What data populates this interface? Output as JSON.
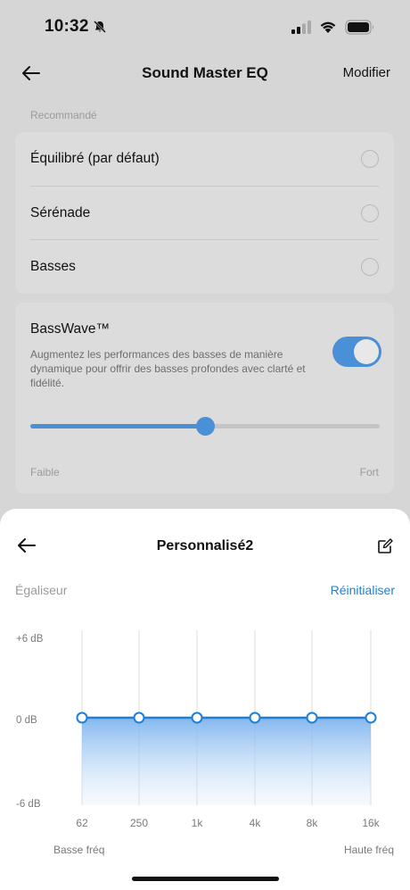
{
  "status_bar": {
    "time": "10:32"
  },
  "header": {
    "title": "Sound Master EQ",
    "edit_label": "Modifier"
  },
  "recommended": {
    "section_label": "Recommandé",
    "presets": [
      {
        "label": "Équilibré (par défaut)",
        "selected": false
      },
      {
        "label": "Sérénade",
        "selected": false
      },
      {
        "label": "Basses",
        "selected": false
      }
    ]
  },
  "basswave": {
    "title": "BassWave™",
    "description": "Augmentez les performances des basses de manière dynamique pour offrir des basses profondes avec clarté et fidélité.",
    "enabled": true,
    "level_fraction": 0.5,
    "low_label": "Faible",
    "high_label": "Fort"
  },
  "sheet": {
    "title": "Personnalisé2",
    "equalizer_label": "Égaliseur",
    "reset_label": "Réinitialiser",
    "y_labels": [
      "+6 dB",
      "0 dB",
      "-6 dB"
    ],
    "bands": [
      {
        "freq": "62",
        "gain_db": 0
      },
      {
        "freq": "250",
        "gain_db": 0
      },
      {
        "freq": "1k",
        "gain_db": 0
      },
      {
        "freq": "4k",
        "gain_db": 0
      },
      {
        "freq": "8k",
        "gain_db": 0
      },
      {
        "freq": "16k",
        "gain_db": 0
      }
    ],
    "freq_low_label": "Basse fréq",
    "freq_high_label": "Haute fréq"
  },
  "colors": {
    "accent": "#4a90d6",
    "link": "#1e7fd6"
  }
}
